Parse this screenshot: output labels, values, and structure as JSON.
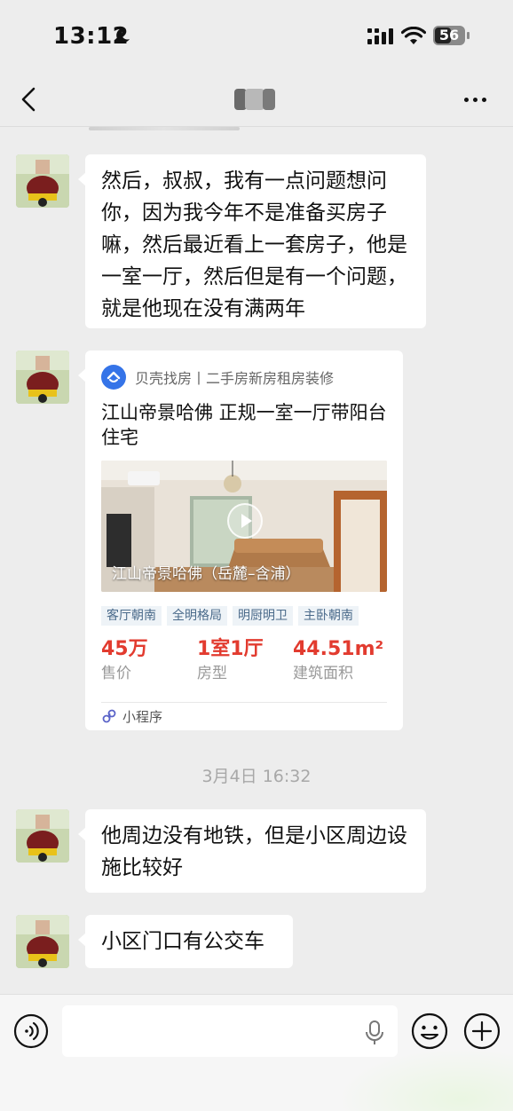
{
  "status_bar": {
    "time": "13:12",
    "battery": "56",
    "icons": [
      "moon-icon",
      "signal-icon",
      "wifi-icon",
      "battery-icon"
    ]
  },
  "nav": {
    "icons": [
      "chevron-left-icon",
      "more-icon"
    ]
  },
  "messages": [
    {
      "type": "text",
      "text": "然后，叔叔，我有一点问题想问你，因为我今年不是准备买房子嘛，然后最近看上一套房子，他是一室一厅，然后但是有一个问题，就是他现在没有满两年"
    },
    {
      "type": "card"
    },
    {
      "type": "text",
      "text": "他周边没有地铁，但是小区周边设施比较好"
    },
    {
      "type": "text",
      "text": "小区门口有公交车"
    }
  ],
  "card": {
    "source": "贝壳找房丨二手房新房租房装修",
    "title": "江山帝景哈佛 正规一室一厅带阳台住宅",
    "image_caption": "江山帝景哈佛（岳麓–含浦）",
    "tags": [
      "客厅朝南",
      "全明格局",
      "明厨明卫",
      "主卧朝南"
    ],
    "stats": [
      {
        "value": "45万",
        "label": "售价"
      },
      {
        "value": "1室1厅",
        "label": "房型"
      },
      {
        "value": "44.51m²",
        "label": "建筑面积"
      }
    ],
    "footer": "小程序"
  },
  "timestamp": "3月4日 16:32",
  "input_bar": {
    "placeholder": "",
    "icons": [
      "voice-icon",
      "mic-icon",
      "emoji-icon",
      "plus-icon"
    ]
  },
  "colors": {
    "background": "#ededed",
    "bubble": "#ffffff",
    "price_red": "#e23b2f",
    "tag_bg": "#eef3f7",
    "tag_text": "#4a6a8a",
    "brand_blue": "#3574e8"
  }
}
